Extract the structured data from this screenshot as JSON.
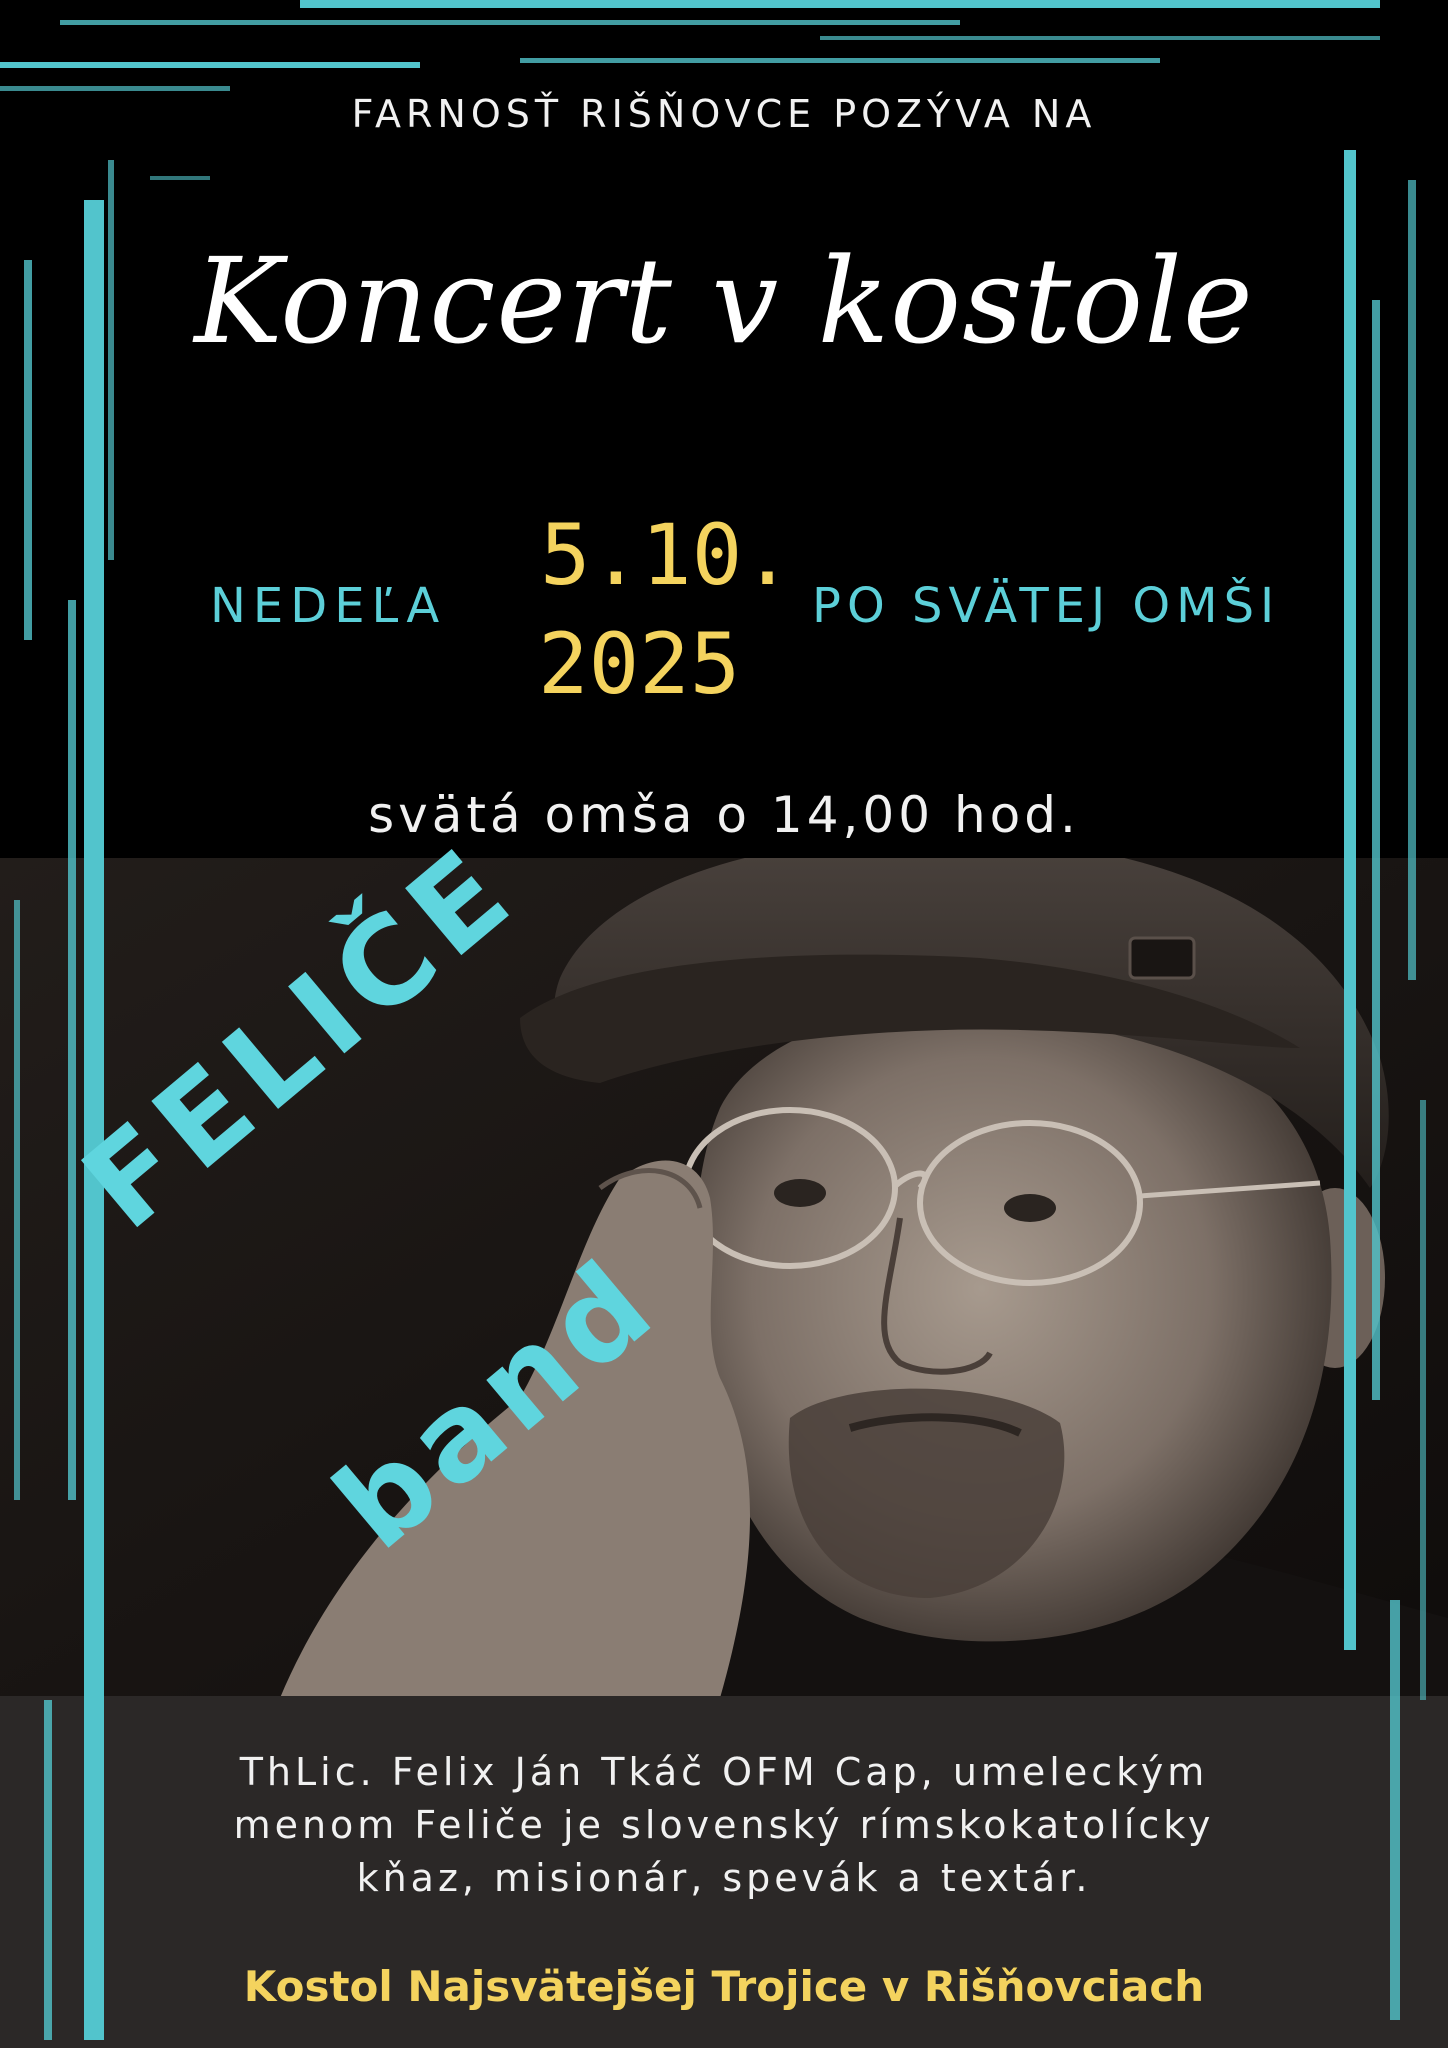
{
  "poster": {
    "invite": "FARNOSŤ RIŠŇOVCE POZÝVA NA",
    "title": "Koncert v kostole",
    "day": "NEDEĽA",
    "date_line1": "5.10.",
    "date_line2": "2025",
    "after_mass": "PO SVÄTEJ OMŠI",
    "mass_time": "svätá omša o 14,00 hod.",
    "band_name": "FELIČE",
    "band_word": "band",
    "bio_lines": [
      "ThLic. Felix Ján Tkáč OFM Cap, umeleckým",
      "menom Feliče  je slovenský rímskokatolícky",
      "kňaz, misionár, spevák a textár."
    ],
    "venue": "Kostol Najsvätejšej Trojice v Rišňovciach"
  },
  "colors": {
    "background": "#000000",
    "accent_teal": "#5ccfd8",
    "accent_yellow": "#f4d35e",
    "text_white": "#f1f1f1",
    "panel": "#2b2827"
  },
  "icons": {
    "photo": "portrait-photo",
    "strokes": "brush-stroke-frame"
  }
}
